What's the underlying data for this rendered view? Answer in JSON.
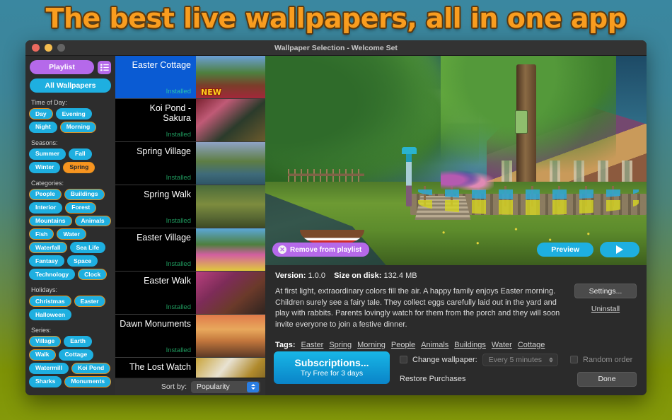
{
  "headline": "The best live wallpapers, all in one app",
  "window": {
    "title": "Wallpaper Selection - Welcome Set"
  },
  "sidebar": {
    "playlist_label": "Playlist",
    "list_icon": "list-view-icon",
    "all_wallpapers_label": "All Wallpapers",
    "groups": [
      {
        "label": "Time of Day:",
        "tags": [
          {
            "label": "Day",
            "state": "bordered"
          },
          {
            "label": "Evening",
            "state": "normal"
          },
          {
            "label": "Night",
            "state": "normal"
          },
          {
            "label": "Morning",
            "state": "bordered"
          }
        ]
      },
      {
        "label": "Seasons:",
        "tags": [
          {
            "label": "Summer",
            "state": "normal"
          },
          {
            "label": "Fall",
            "state": "normal"
          },
          {
            "label": "Winter",
            "state": "normal"
          },
          {
            "label": "Spring",
            "state": "active"
          }
        ]
      },
      {
        "label": "Categories:",
        "tags": [
          {
            "label": "People",
            "state": "bordered"
          },
          {
            "label": "Buildings",
            "state": "bordered"
          },
          {
            "label": "Interior",
            "state": "normal"
          },
          {
            "label": "Forest",
            "state": "bordered"
          },
          {
            "label": "Mountains",
            "state": "bordered"
          },
          {
            "label": "Animals",
            "state": "bordered"
          },
          {
            "label": "Fish",
            "state": "bordered"
          },
          {
            "label": "Water",
            "state": "bordered"
          },
          {
            "label": "Waterfall",
            "state": "bordered"
          },
          {
            "label": "Sea Life",
            "state": "normal"
          },
          {
            "label": "Fantasy",
            "state": "normal"
          },
          {
            "label": "Space",
            "state": "normal"
          },
          {
            "label": "Technology",
            "state": "normal"
          },
          {
            "label": "Clock",
            "state": "bordered"
          }
        ]
      },
      {
        "label": "Holidays:",
        "tags": [
          {
            "label": "Christmas",
            "state": "bordered"
          },
          {
            "label": "Easter",
            "state": "bordered"
          },
          {
            "label": "Halloween",
            "state": "normal"
          }
        ]
      },
      {
        "label": "Series:",
        "tags": [
          {
            "label": "Village",
            "state": "bordered"
          },
          {
            "label": "Earth",
            "state": "normal"
          },
          {
            "label": "Walk",
            "state": "bordered"
          },
          {
            "label": "Cottage",
            "state": "normal"
          },
          {
            "label": "Watermill",
            "state": "normal"
          },
          {
            "label": "Koi Pond",
            "state": "bordered"
          },
          {
            "label": "Sharks",
            "state": "normal"
          },
          {
            "label": "Monuments",
            "state": "bordered"
          }
        ]
      }
    ]
  },
  "wallpaper_list": {
    "items": [
      {
        "name": "Easter Cottage",
        "status": "Installed",
        "selected": true,
        "badge": "NEW",
        "thumb": "easter-cottage-thumb"
      },
      {
        "name": "Koi Pond - Sakura",
        "status": "Installed",
        "selected": false,
        "badge": "",
        "thumb": "koi-pond-sakura-thumb"
      },
      {
        "name": "Spring Village",
        "status": "Installed",
        "selected": false,
        "badge": "",
        "thumb": "spring-village-thumb"
      },
      {
        "name": "Spring Walk",
        "status": "Installed",
        "selected": false,
        "badge": "",
        "thumb": "spring-walk-thumb"
      },
      {
        "name": "Easter Village",
        "status": "Installed",
        "selected": false,
        "badge": "",
        "thumb": "easter-village-thumb"
      },
      {
        "name": "Easter Walk",
        "status": "Installed",
        "selected": false,
        "badge": "",
        "thumb": "easter-walk-thumb"
      },
      {
        "name": "Dawn Monuments",
        "status": "Installed",
        "selected": false,
        "badge": "",
        "thumb": "dawn-monuments-thumb"
      },
      {
        "name": "The Lost Watch",
        "status": "",
        "selected": false,
        "badge": "",
        "thumb": "lost-watch-thumb"
      }
    ],
    "sort_label": "Sort by:",
    "sort_value": "Popularity"
  },
  "preview": {
    "remove_label": "Remove from playlist",
    "preview_label": "Preview",
    "play_icon": "play-icon",
    "remove_icon": "close-circle-icon"
  },
  "details": {
    "version_label": "Version:",
    "version_value": "1.0.0",
    "size_label": "Size on disk:",
    "size_value": "132.4 MB",
    "description": "At first light, extraordinary colors fill the air. A happy family enjoys Easter morning. Children surely see a fairy tale. They collect eggs carefully laid out in the yard and play with rabbits. Parents lovingly watch for them from the porch and they will soon invite everyone to join a festive dinner.",
    "tags_label": "Tags:",
    "tags": [
      "Easter",
      "Spring",
      "Morning",
      "People",
      "Animals",
      "Buildings",
      "Water",
      "Cottage"
    ],
    "settings_label": "Settings...",
    "uninstall_label": "Uninstall"
  },
  "bottom": {
    "subscriptions_line1": "Subscriptions...",
    "subscriptions_line2": "Try Free for 3 days",
    "change_wallpaper_label": "Change wallpaper:",
    "interval_value": "Every 5 minutes",
    "random_order_label": "Random order",
    "restore_label": "Restore Purchases",
    "done_label": "Done"
  },
  "colors": {
    "accent_blue": "#1eafe0",
    "accent_purple": "#b569ea",
    "accent_orange": "#f79420",
    "selected_row": "#0a5bd3",
    "installed_green": "#1f9a5e",
    "headline_orange": "#f99d1f"
  }
}
